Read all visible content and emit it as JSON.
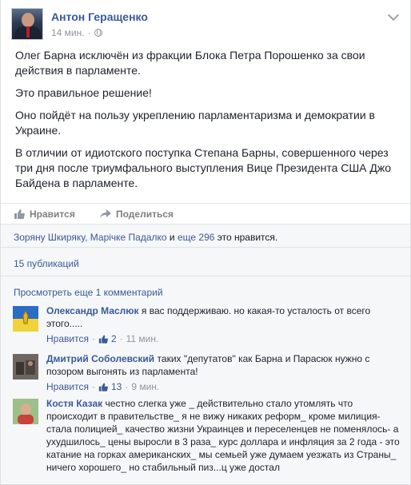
{
  "post": {
    "author": "Антон Геращенко",
    "time": "14 мин.",
    "sep": "·",
    "paragraphs": [
      "Олег Барна исключён из фракции Блока Петра Порошенко за свои действия в парламенте.",
      "Это правильное решение!",
      "Оно пойдёт на пользу укреплению парламентаризма и демократии в Украине.",
      "В отличии от идиотского поступка Степана Барны, совершенного через три дня после триумфального выступления Вице Президента США Джо Байдена в парламенте."
    ]
  },
  "actions": {
    "like": "Нравится",
    "share": "Поделиться"
  },
  "likes": {
    "names": "Зоряну Шкиряку, Марічке Падалко",
    "and": " и ",
    "more": "еще 296",
    "suffix": " это нравится."
  },
  "shares": "15 публикаций",
  "view_more": "Просмотреть еще 1 комментарий",
  "comments": [
    {
      "name": "Олександр Маслюк",
      "text": "я вас поддерживаю. но какая-то усталость от всего этого.....",
      "like": "Нравится",
      "count": "2",
      "time": "11 мин."
    },
    {
      "name": "Дмитрий Соболевский",
      "text": "таких \"депутатов\" как Барна и Парасюк нужно с позором выгонять из парламента!",
      "like": "Нравится",
      "count": "13",
      "time": "9 мин."
    },
    {
      "name": "Костя Казак",
      "text": "честно слегка уже _ действительно стало утомлять что происходит в правительстве_ я не вижу никаких реформ_ кроме милиция-стала полицией_ качество жизни Украинцев и переселенцев не поменялось- а ухудшилось_ цены выросли в 3 раза_ курс доллара и инфляция за 2 года - это катание на горках американских_ мы семьей уже думаем уезжать из Страны_ ничего хорошего_ но стабильный пиз...ц уже достал"
    }
  ],
  "colors": {
    "link": "#3b5998",
    "muted": "#90949c"
  }
}
